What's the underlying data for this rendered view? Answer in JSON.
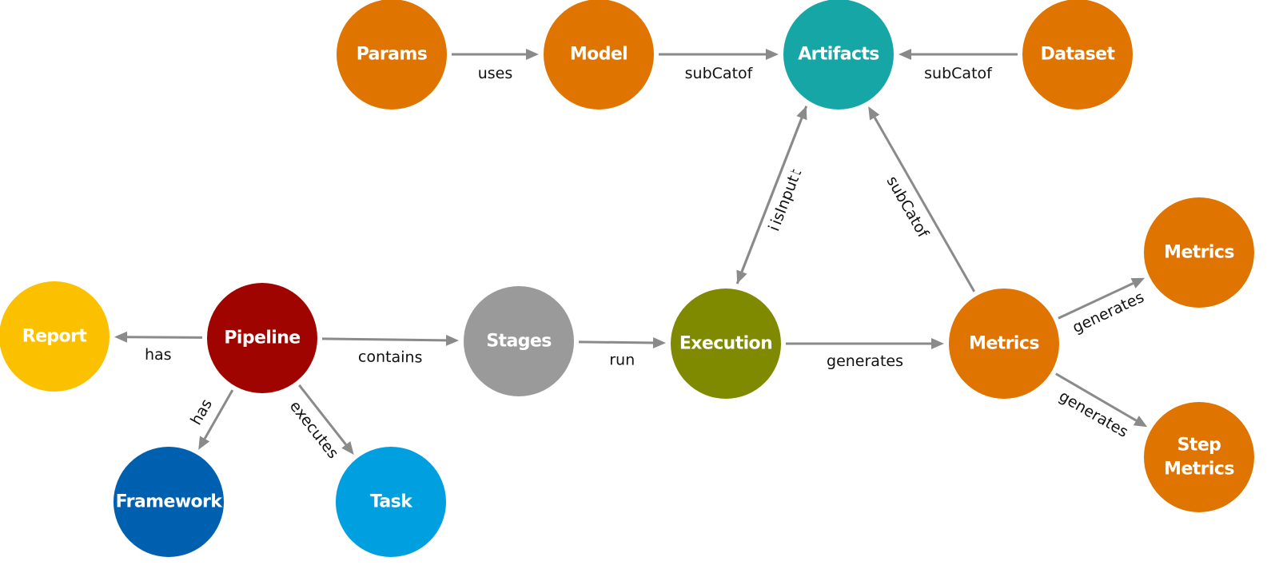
{
  "diagram": {
    "type": "knowledge-graph",
    "edge_color": "#8a8a8a",
    "nodes": [
      {
        "id": "params",
        "label": "Params",
        "color": "#E07400"
      },
      {
        "id": "model",
        "label": "Model",
        "color": "#E07400"
      },
      {
        "id": "artifacts",
        "label": "Artifacts",
        "color": "#16A6A6"
      },
      {
        "id": "dataset",
        "label": "Dataset",
        "color": "#E07400"
      },
      {
        "id": "report",
        "label": "Report",
        "color": "#FBC100"
      },
      {
        "id": "pipeline",
        "label": "Pipeline",
        "color": "#A00400"
      },
      {
        "id": "stages",
        "label": "Stages",
        "color": "#9A9A9A"
      },
      {
        "id": "execution",
        "label": "Execution",
        "color": "#7F8A00"
      },
      {
        "id": "metrics",
        "label": "Metrics",
        "color": "#E07400"
      },
      {
        "id": "metrics2",
        "label": "Metrics",
        "color": "#E07400"
      },
      {
        "id": "stepmetrics",
        "label": "Step Metrics",
        "lines": [
          "Step",
          "Metrics"
        ],
        "color": "#E07400"
      },
      {
        "id": "framework",
        "label": "Framework",
        "color": "#0060B0"
      },
      {
        "id": "task",
        "label": "Task",
        "color": "#009FE0"
      }
    ],
    "edges": [
      {
        "from": "params",
        "to": "model",
        "label": "uses"
      },
      {
        "from": "model",
        "to": "artifacts",
        "label": "subCatof"
      },
      {
        "from": "dataset",
        "to": "artifacts",
        "label": "subCatof"
      },
      {
        "from": "pipeline",
        "to": "report",
        "label": "has"
      },
      {
        "from": "pipeline",
        "to": "stages",
        "label": "contains"
      },
      {
        "from": "stages",
        "to": "execution",
        "label": "run"
      },
      {
        "from": "execution",
        "to": "metrics",
        "label": "generates"
      },
      {
        "from": "execution",
        "to": "artifacts",
        "label": "isOutput"
      },
      {
        "from": "artifacts",
        "to": "execution",
        "label": "isInput"
      },
      {
        "from": "metrics",
        "to": "artifacts",
        "label": "subCatof"
      },
      {
        "from": "metrics",
        "to": "metrics2",
        "label": "generates"
      },
      {
        "from": "metrics",
        "to": "stepmetrics",
        "label": "generates"
      },
      {
        "from": "pipeline",
        "to": "framework",
        "label": "has"
      },
      {
        "from": "pipeline",
        "to": "task",
        "label": "executes"
      }
    ]
  }
}
